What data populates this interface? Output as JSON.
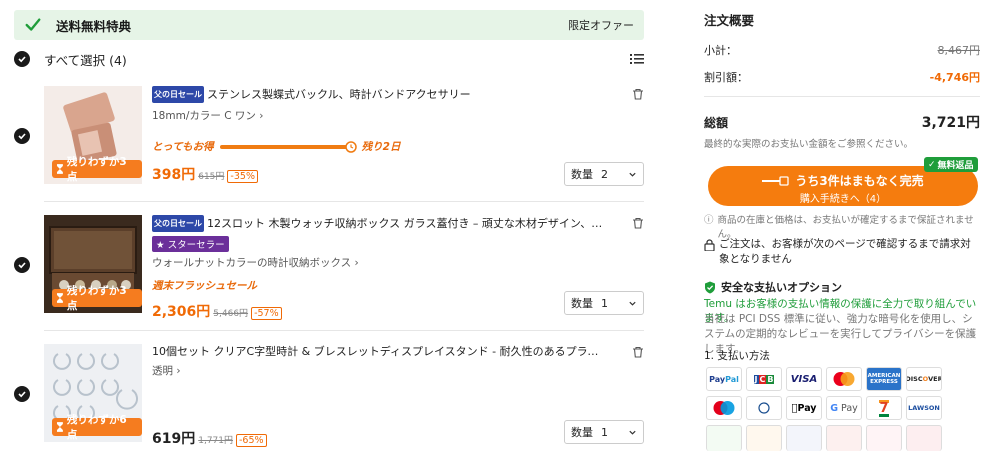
{
  "banner": {
    "title": "送料無料特典",
    "right_text": "限定オファー"
  },
  "select_all": {
    "label": "すべて選択 (4)"
  },
  "items": [
    {
      "tag": "父の日セール",
      "name": "ステンレス製蝶式バックル、時計バンドアクセサリー",
      "variant": "18mm/カラー C ワン",
      "promo_left": "とってもお得",
      "promo_right": "残り2日",
      "stock_badge": "残りわずか3点",
      "price": "398円",
      "old_price": "615円",
      "discount": "-35%",
      "qty_label": "数量",
      "qty_value": "2"
    },
    {
      "tag": "父の日セール",
      "name": "12スロット 木製ウォッチ収納ボックス ガラス蓋付き – 頑丈な木材デザイン、防塵·耐傷性、お手入...",
      "star": "スターセラー",
      "variant": "ウォールナットカラーの時計収納ボックス",
      "promo": "週末フラッシュセール",
      "stock_badge": "残りわずか3点",
      "price": "2,306円",
      "old_price": "5,466円",
      "discount": "-57%",
      "qty_label": "数量",
      "qty_value": "1"
    },
    {
      "name": "10個セット クリアC字型時計 & ブレスレットディスプレイスタンド - 耐久性のあるプラスチック、ジュエリーやアクセ...",
      "variant": "透明",
      "stock_badge": "残りわずか6点",
      "price": "619円",
      "old_price": "1,771円",
      "discount": "-65%",
      "qty_label": "数量",
      "qty_value": "1"
    }
  ],
  "summary": {
    "title": "注文概要",
    "subtotal_label": "小計：",
    "subtotal_value": "8,467円",
    "discount_label": "割引額：",
    "discount_value": "-4,746円",
    "total_label": "総額",
    "total_value": "3,721円",
    "total_note": "最終的な実際のお支払い金額をご参照ください。",
    "checkout_line1": "うち3件はまもなく完売",
    "checkout_line2": "購入手続きへ（4）",
    "free_return": "無料返品",
    "stock_note": "商品の在庫と価格は、お支払いが確定するまで保証されません。",
    "lock_note": "ご注文は、お客様が次のページで確認するまで請求対象となりません",
    "secure_title": "安全な支払いオプション",
    "secure_green": "Temu はお客様の支払い情報の保護に全力で取り組んでいます。",
    "secure_gray": "当社は PCI DSS 標準に従い、強力な暗号化を使用し、システムの定期的なレビューを実行してプライバシーを保護します。",
    "payment_title": "1. 支払い方法",
    "payment_methods": [
      "PayPal",
      "JCB",
      "VISA",
      "Mastercard",
      "AMERICAN EXPRESS",
      "DISCOVER",
      "Maestro",
      "Diners Club",
      "Apple Pay",
      "G Pay",
      "7-Eleven",
      "LAWSON"
    ]
  },
  "colors": {
    "accent": "#f57c0e",
    "green": "#1f9d3a",
    "banner_bg": "#e6f4e7",
    "sale_tag": "#2d48a8",
    "star_tag": "#6b2f9a"
  }
}
